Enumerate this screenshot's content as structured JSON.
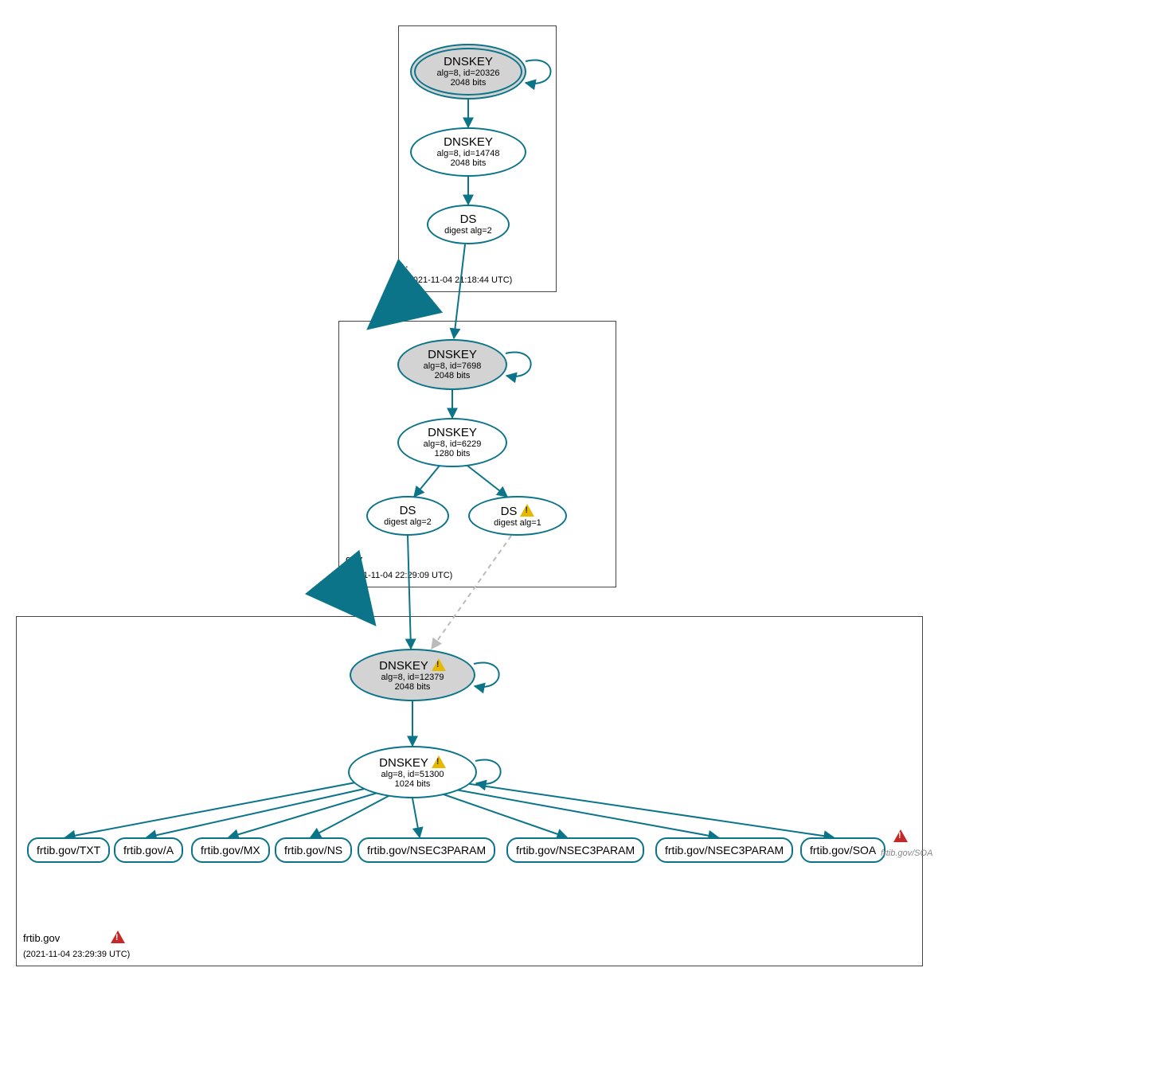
{
  "colors": {
    "stroke": "#0c7489",
    "fill_sep": "#d3d3d3"
  },
  "zones": {
    "root": {
      "name": ".",
      "timestamp": "(2021-11-04 21:18:44 UTC)"
    },
    "gov": {
      "name": "gov",
      "timestamp": "(2021-11-04 22:29:09 UTC)"
    },
    "frtib": {
      "name": "frtib.gov",
      "timestamp": "(2021-11-04 23:29:39 UTC)"
    }
  },
  "nodes": {
    "root_ksk": {
      "title": "DNSKEY",
      "line1": "alg=8, id=20326",
      "line2": "2048 bits"
    },
    "root_zsk": {
      "title": "DNSKEY",
      "line1": "alg=8, id=14748",
      "line2": "2048 bits"
    },
    "root_ds": {
      "title": "DS",
      "line1": "digest alg=2"
    },
    "gov_ksk": {
      "title": "DNSKEY",
      "line1": "alg=8, id=7698",
      "line2": "2048 bits"
    },
    "gov_zsk": {
      "title": "DNSKEY",
      "line1": "alg=8, id=6229",
      "line2": "1280 bits"
    },
    "gov_ds1": {
      "title": "DS",
      "line1": "digest alg=2"
    },
    "gov_ds2": {
      "title": "DS",
      "line1": "digest alg=1",
      "warn": true
    },
    "frtib_ksk": {
      "title": "DNSKEY",
      "line1": "alg=8, id=12379",
      "line2": "2048 bits",
      "warn": true
    },
    "frtib_zsk": {
      "title": "DNSKEY",
      "line1": "alg=8, id=51300",
      "line2": "1024 bits",
      "warn": true
    }
  },
  "leaves": {
    "l0": "frtib.gov/TXT",
    "l1": "frtib.gov/A",
    "l2": "frtib.gov/MX",
    "l3": "frtib.gov/NS",
    "l4": "frtib.gov/NSEC3PARAM",
    "l5": "frtib.gov/NSEC3PARAM",
    "l6": "frtib.gov/NSEC3PARAM",
    "l7": "frtib.gov/SOA",
    "l8": "frtib.gov/SOA"
  }
}
